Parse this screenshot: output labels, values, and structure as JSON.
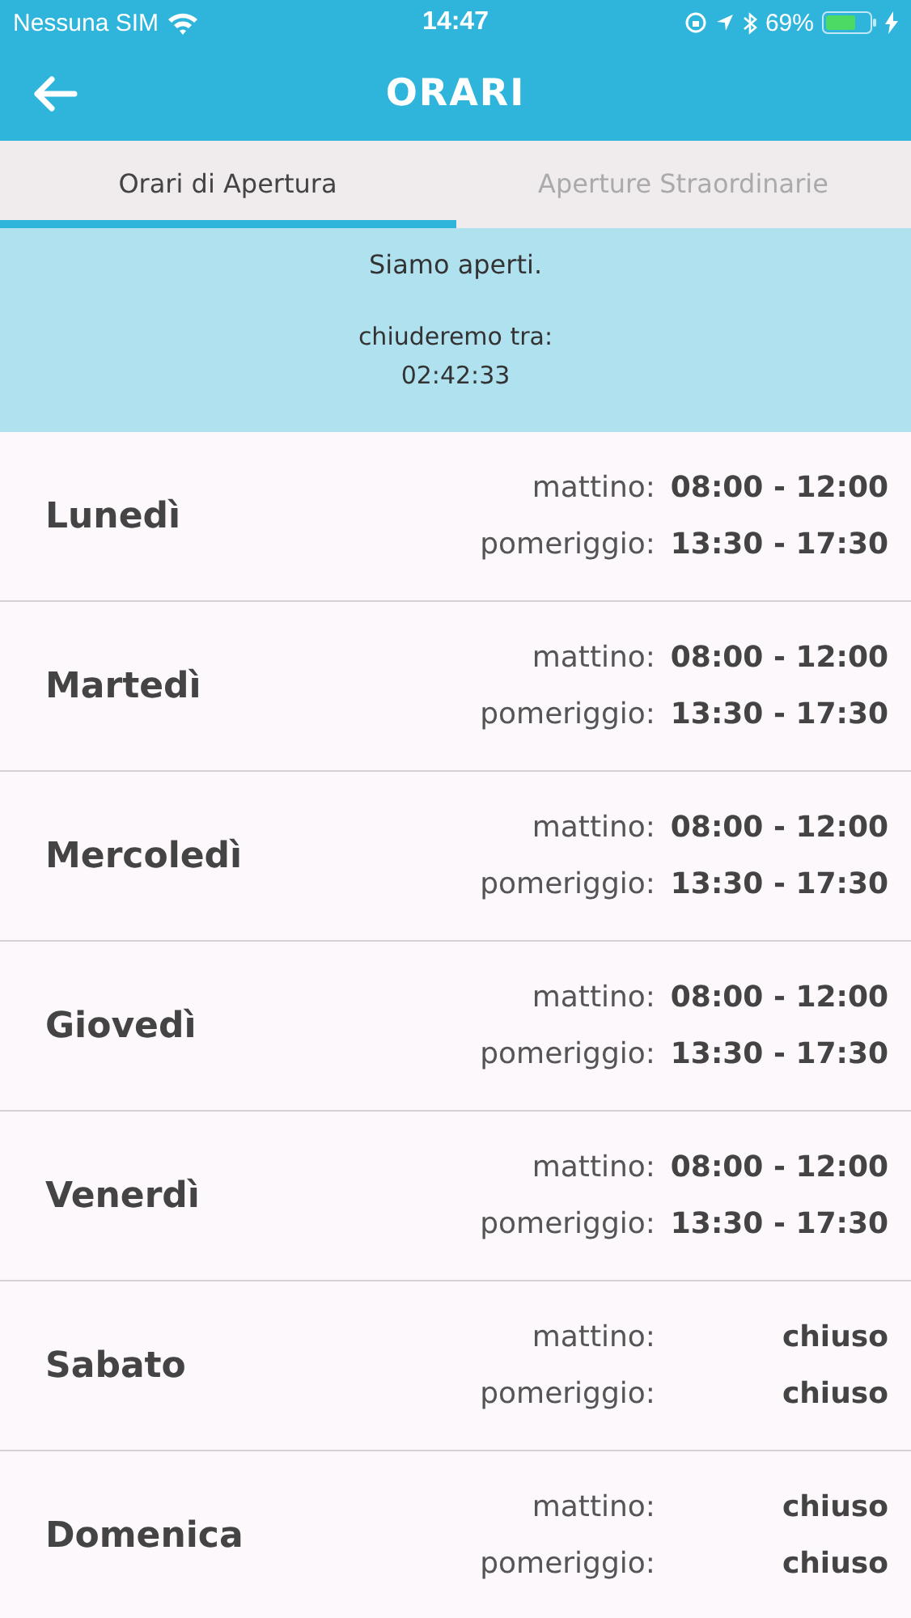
{
  "status_bar": {
    "carrier": "Nessuna SIM",
    "time": "14:47",
    "battery": "69%"
  },
  "header": {
    "title": "ORARI"
  },
  "tabs": [
    {
      "label": "Orari di Apertura",
      "selected": true
    },
    {
      "label": "Aperture Straordinarie",
      "selected": false
    }
  ],
  "status_panel": {
    "message": "Siamo aperti.",
    "countdown_label": "chiuderemo tra:",
    "countdown": "02:42:33"
  },
  "days": [
    {
      "name": "Lunedì",
      "slots": [
        {
          "label": "mattino:",
          "hours": "08:00 - 12:00"
        },
        {
          "label": "pomeriggio:",
          "hours": "13:30 - 17:30"
        }
      ]
    },
    {
      "name": "Martedì",
      "slots": [
        {
          "label": "mattino:",
          "hours": "08:00 - 12:00"
        },
        {
          "label": "pomeriggio:",
          "hours": "13:30 - 17:30"
        }
      ]
    },
    {
      "name": "Mercoledì",
      "slots": [
        {
          "label": "mattino:",
          "hours": "08:00 - 12:00"
        },
        {
          "label": "pomeriggio:",
          "hours": "13:30 - 17:30"
        }
      ]
    },
    {
      "name": "Giovedì",
      "slots": [
        {
          "label": "mattino:",
          "hours": "08:00 - 12:00"
        },
        {
          "label": "pomeriggio:",
          "hours": "13:30 - 17:30"
        }
      ]
    },
    {
      "name": "Venerdì",
      "slots": [
        {
          "label": "mattino:",
          "hours": "08:00 - 12:00"
        },
        {
          "label": "pomeriggio:",
          "hours": "13:30 - 17:30"
        }
      ]
    },
    {
      "name": "Sabato",
      "slots": [
        {
          "label": "mattino:",
          "hours": "chiuso"
        },
        {
          "label": "pomeriggio:",
          "hours": "chiuso"
        }
      ]
    },
    {
      "name": "Domenica",
      "slots": [
        {
          "label": "mattino:",
          "hours": "chiuso"
        },
        {
          "label": "pomeriggio:",
          "hours": "chiuso"
        }
      ]
    }
  ]
}
